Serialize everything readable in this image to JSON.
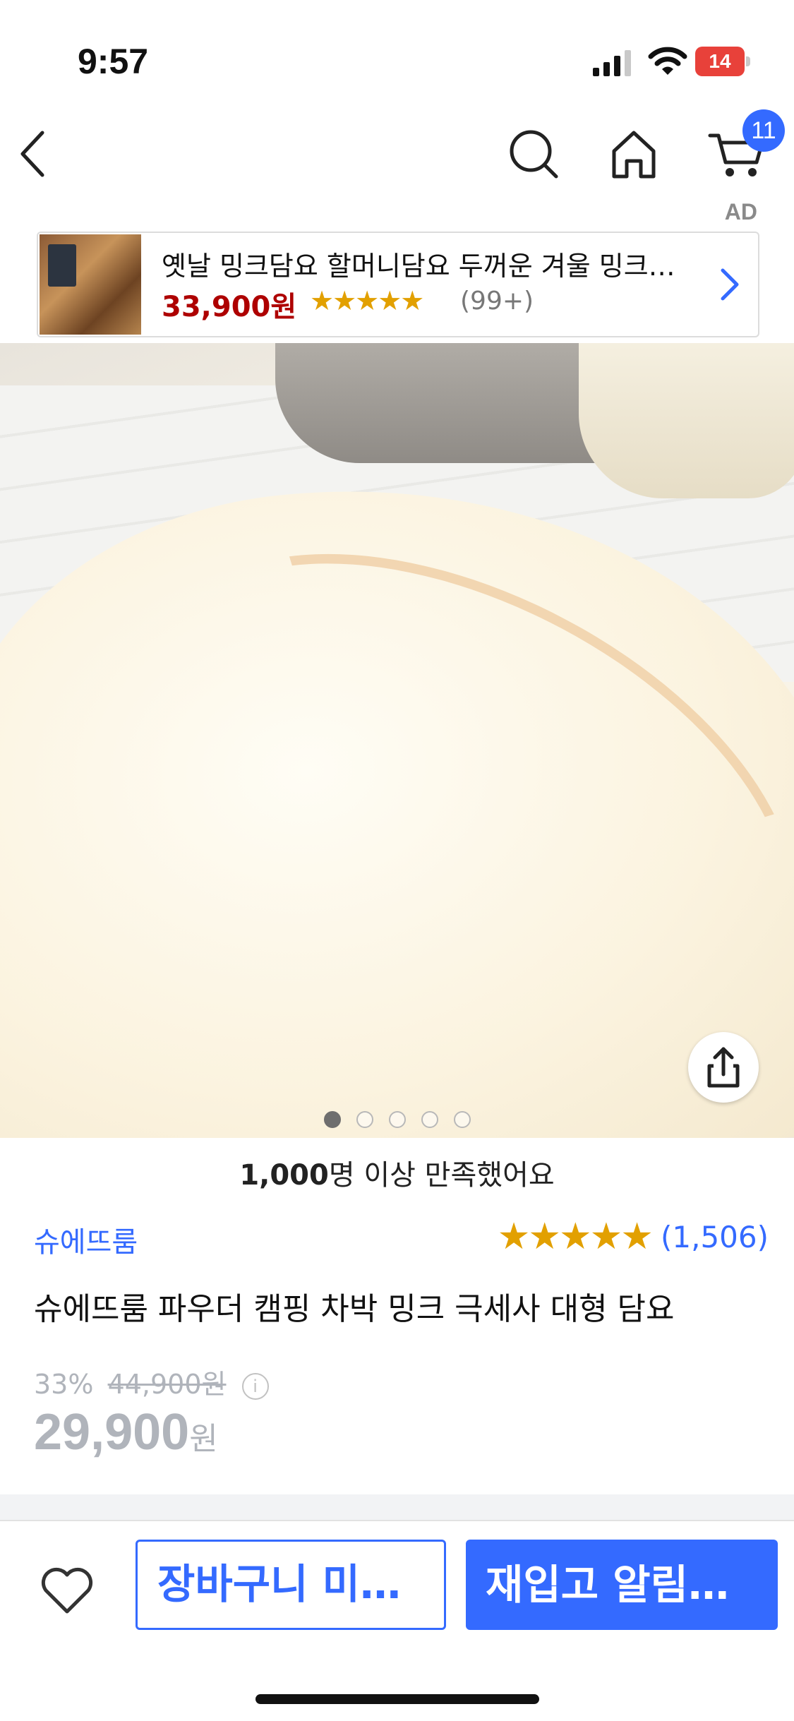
{
  "status": {
    "time": "9:57",
    "battery": "14"
  },
  "nav": {
    "cart_count": "11"
  },
  "ad": {
    "label": "AD",
    "title": "옛날 밍크담요 할머니담요 두꺼운 겨울 밍크…",
    "price": "33,900원",
    "rating": 4.5,
    "stars": "★★★★★",
    "review_count": "(99+)"
  },
  "gallery": {
    "total": 5,
    "current": 1
  },
  "product": {
    "satisfied_bold": "1,000",
    "satisfied_rest": "명 이상 만족했어요",
    "brand": "슈에뜨룸",
    "rating": 4.5,
    "stars": "★★★★★",
    "review_count": "(1,506)",
    "name": "슈에뜨룸 파우더 캠핑 차박 밍크 극세사 대형 담요",
    "discount": "33%",
    "original_price": "44,900원",
    "price": "29,900",
    "price_unit": "원"
  },
  "actions": {
    "cart_label": "장바구니 미…",
    "restock_label": "재입고 알림…"
  },
  "colors": {
    "accent": "#346aff",
    "ad_price": "#ae0000",
    "star": "#e2a000"
  }
}
